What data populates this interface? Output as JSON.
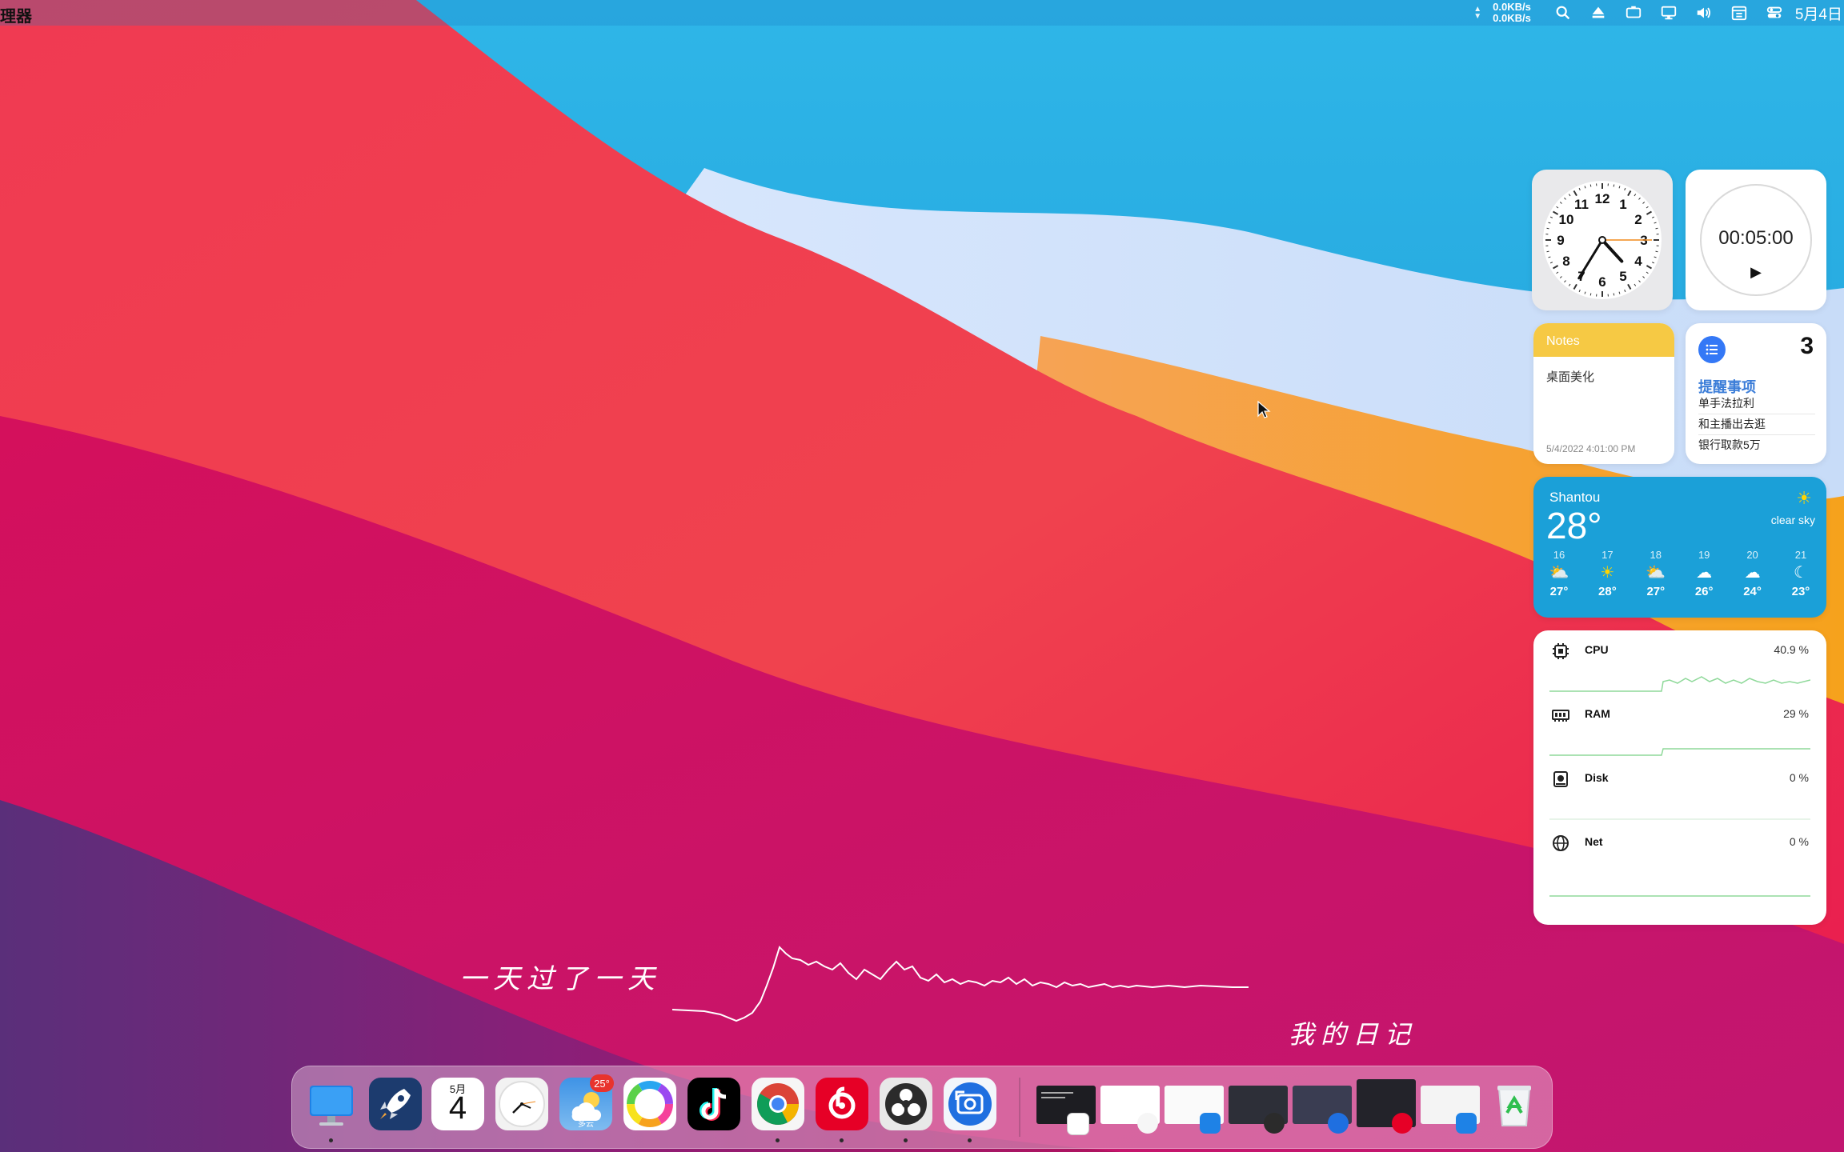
{
  "menubar": {
    "app_name": "理器",
    "net_up": "0.0KB/s",
    "net_down": "0.0KB/s",
    "date_text": "5月4日",
    "icons": [
      "search-icon",
      "eject-icon",
      "display-icon",
      "monitor-icon",
      "volume-icon",
      "calendar-icon",
      "control-center-icon"
    ]
  },
  "clock": {
    "hour": 4,
    "minute": 35,
    "second": 15
  },
  "timer": {
    "time": "00:05:00",
    "play_icon": "play-icon"
  },
  "notes": {
    "header": "Notes",
    "body": "桌面美化",
    "date": "5/4/2022 4:01:00 PM"
  },
  "reminders": {
    "count": "3",
    "title": "提醒事项",
    "items": [
      "单手法拉利",
      "和主播出去逛",
      "银行取款5万"
    ]
  },
  "weather": {
    "city": "Shantou",
    "temp": "28°",
    "condition": "clear sky",
    "forecast": [
      {
        "day": "16",
        "icon": "partly-sunny",
        "temp": "27°"
      },
      {
        "day": "17",
        "icon": "sunny",
        "temp": "28°"
      },
      {
        "day": "18",
        "icon": "partly-sunny",
        "temp": "27°"
      },
      {
        "day": "19",
        "icon": "cloudy",
        "temp": "26°"
      },
      {
        "day": "20",
        "icon": "cloudy",
        "temp": "24°"
      },
      {
        "day": "21",
        "icon": "moon",
        "temp": "23°"
      }
    ]
  },
  "stats": [
    {
      "name": "CPU",
      "value": "40.9 %"
    },
    {
      "name": "RAM",
      "value": "29 %"
    },
    {
      "name": "Disk",
      "value": "0 %"
    },
    {
      "name": "Net",
      "value": "0 %"
    }
  ],
  "lyrics": {
    "line1": "一天过了一天",
    "line2": "我的日记"
  },
  "dock": {
    "apps": [
      "finder",
      "launchpad",
      "calendar",
      "clock",
      "weather",
      "color-wheel",
      "tiktok",
      "chrome",
      "netease-music",
      "obs",
      "screenshot"
    ],
    "calendar_month": "5月",
    "calendar_day": "4",
    "weather_badge": "25°",
    "weather_label": "多云"
  },
  "colors": {
    "accent": "#3478f6",
    "notes_yellow": "#f6c944",
    "weather_blue": "#1ba0d8",
    "graph_green": "#5cc86a"
  }
}
